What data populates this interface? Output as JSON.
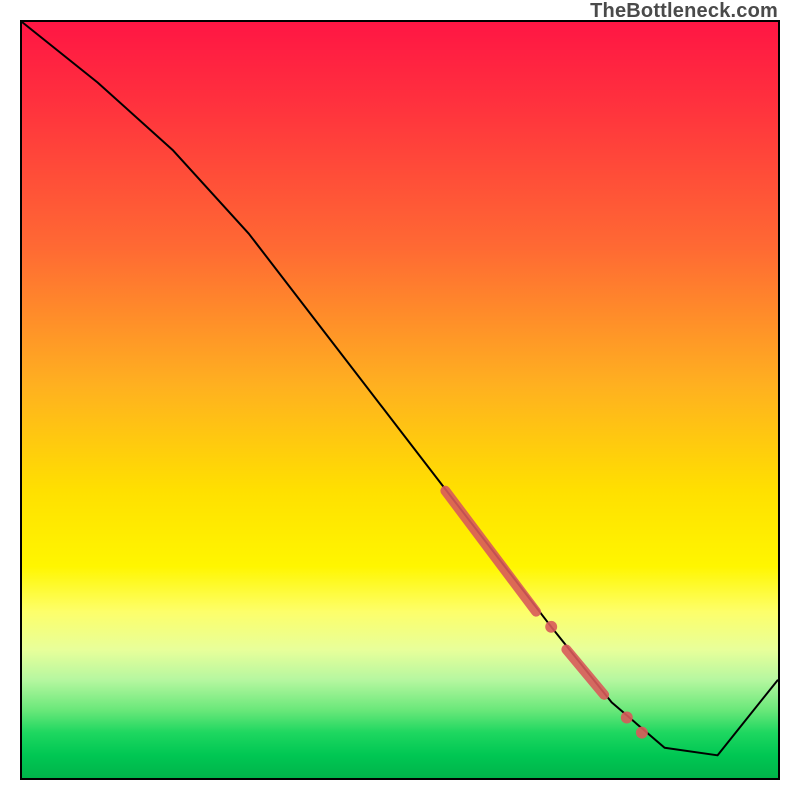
{
  "watermark": "TheBottleneck.com",
  "chart_data": {
    "type": "line",
    "title": "",
    "xlabel": "",
    "ylabel": "",
    "xlim": [
      0,
      100
    ],
    "ylim": [
      0,
      100
    ],
    "series": [
      {
        "name": "main-curve",
        "x": [
          0,
          10,
          20,
          30,
          40,
          50,
          60,
          70,
          78,
          85,
          92,
          100
        ],
        "y": [
          100,
          92,
          83,
          72,
          59,
          46,
          33,
          20,
          10,
          4,
          3,
          13
        ]
      }
    ],
    "highlight_segments": [
      {
        "x0": 56,
        "y0": 38,
        "x1": 68,
        "y1": 22
      },
      {
        "x0": 72,
        "y0": 17,
        "x1": 77,
        "y1": 11
      }
    ],
    "highlight_points": [
      {
        "x": 70,
        "y": 20
      },
      {
        "x": 80,
        "y": 8
      },
      {
        "x": 82,
        "y": 6
      }
    ],
    "background_gradient": {
      "top": "#ff1644",
      "mid_high": "#ffb020",
      "mid": "#fff600",
      "mid_low": "#b6f7a0",
      "bottom": "#00b44a"
    }
  }
}
